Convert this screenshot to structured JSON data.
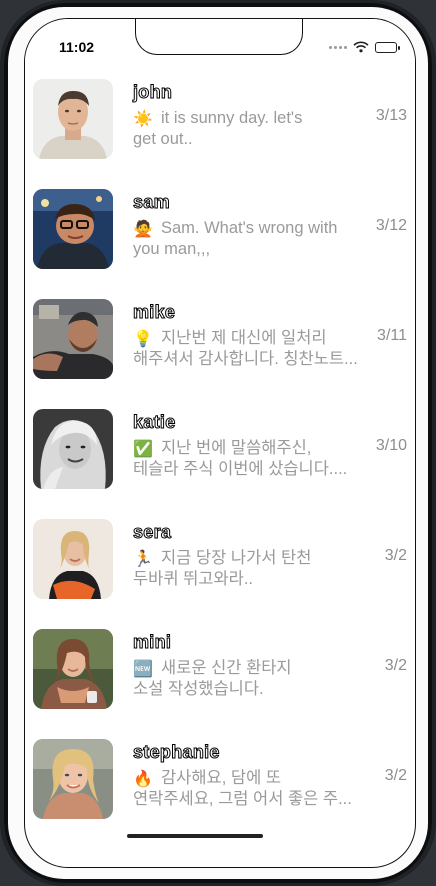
{
  "status_bar": {
    "time": "11:02"
  },
  "chats": [
    {
      "name": "john",
      "icon": "sun-icon",
      "emoji": "☀️",
      "message": "it is sunny day. let's\nget out..",
      "date": "3/13"
    },
    {
      "name": "sam",
      "icon": "see-no-evil-person-icon",
      "emoji": "🙅",
      "message": "Sam. What's wrong with\nyou man,,,",
      "date": "3/12"
    },
    {
      "name": "mike",
      "icon": "lightbulb-icon",
      "emoji": "💡",
      "message": "지난번 제 대신에 일처리\n해주셔서 감사합니다. 칭찬노트...",
      "date": "3/11"
    },
    {
      "name": "katie",
      "icon": "check-mark-icon",
      "emoji": "✅",
      "message": "지난 번에 말씀해주신,\n테슬라 주식 이번에 샀습니다....",
      "date": "3/10"
    },
    {
      "name": "sera",
      "icon": "running-person-icon",
      "emoji": "🏃",
      "message": "지금 당장 나가서 탄천\n두바퀴 뛰고와라..",
      "date": "3/2"
    },
    {
      "name": "mini",
      "icon": "new-badge-icon",
      "emoji": "🆕",
      "message": "새로운 신간 환타지\n소설 작성했습니다.",
      "date": "3/2"
    },
    {
      "name": "stephanie",
      "icon": "fire-icon",
      "emoji": "🔥",
      "message": "감사해요, 담에 또\n연락주세요, 그럼 어서 좋은 주...",
      "date": "3/2"
    }
  ]
}
